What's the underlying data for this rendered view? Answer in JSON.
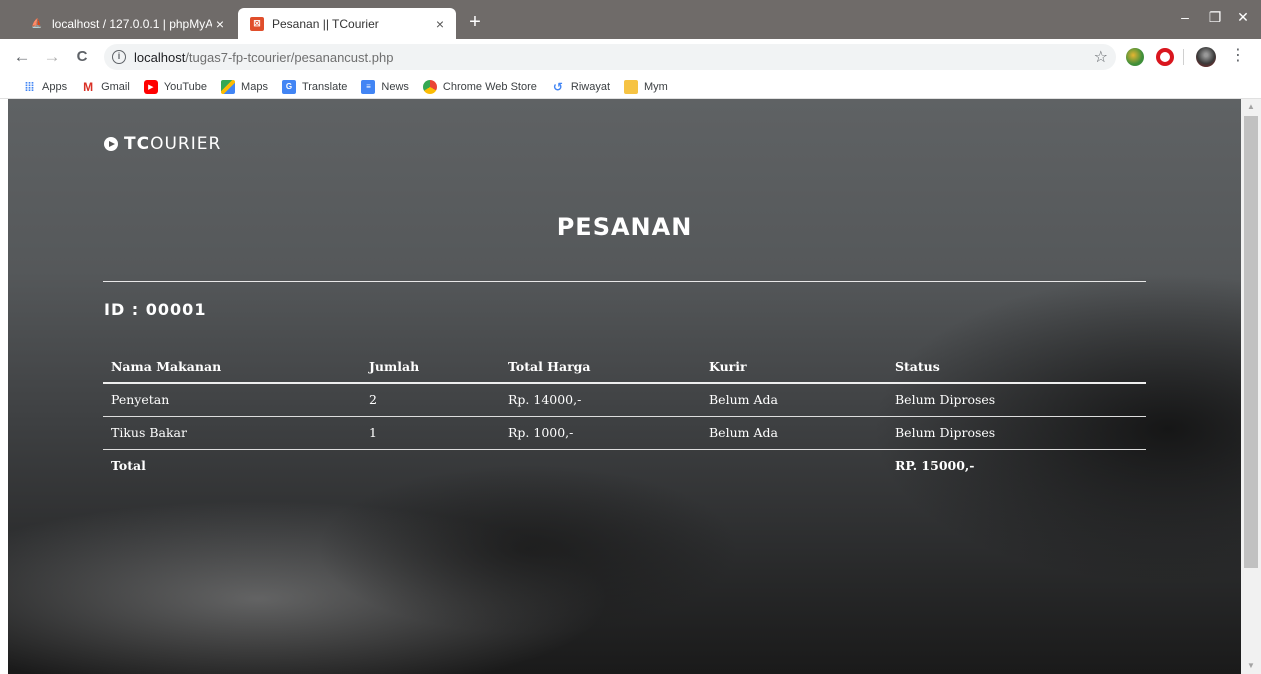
{
  "browser": {
    "tabs": [
      {
        "title": "localhost / 127.0.0.1 | phpMyAdm",
        "close": "×",
        "favicon": "phpmyadmin-icon"
      },
      {
        "title": "Pesanan || TCourier",
        "close": "×",
        "favicon": "tcourier-icon"
      }
    ],
    "new_tab": "+",
    "window": {
      "minimize": "–",
      "maximize": "❐",
      "close": "✕"
    },
    "nav": {
      "back": "←",
      "forward": "→",
      "reload": "C"
    },
    "url": {
      "host": "localhost",
      "path": "/tugas7-fp-tcourier/pesanancust.php"
    },
    "bookmarks": [
      "Apps",
      "Gmail",
      "YouTube",
      "Maps",
      "Translate",
      "News",
      "Chrome Web Store",
      "Riwayat",
      "Mym"
    ]
  },
  "page": {
    "logo": {
      "bold": "TC",
      "rest": "OURIER"
    },
    "title": "PESANAN",
    "order_id_label": "ID : ",
    "order_id": "00001",
    "table": {
      "headers": [
        "Nama Makanan",
        "Jumlah",
        "Total Harga",
        "Kurir",
        "Status"
      ],
      "rows": [
        [
          "Penyetan",
          "2",
          "Rp. 14000,-",
          "Belum Ada",
          "Belum Diproses"
        ],
        [
          "Tikus Bakar",
          "1",
          "Rp. 1000,-",
          "Belum Ada",
          "Belum Diproses"
        ]
      ],
      "total_label": "Total",
      "total_value": "RP. 15000,-"
    }
  }
}
